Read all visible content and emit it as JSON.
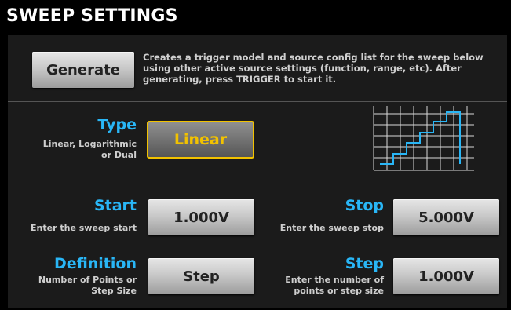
{
  "header": {
    "title": "SWEEP SETTINGS"
  },
  "generate": {
    "label": "Generate",
    "description": "Creates a trigger model and source config list for the sweep below using other active source settings (function, range, etc). After generating, press TRIGGER to start it."
  },
  "type": {
    "label": "Type",
    "subtitle_line1": "Linear, Logarithmic",
    "subtitle_line2": "or Dual",
    "value": "Linear"
  },
  "start": {
    "label": "Start",
    "subtitle": "Enter the sweep start",
    "value": "1.000V"
  },
  "stop": {
    "label": "Stop",
    "subtitle": "Enter the sweep stop",
    "value": "5.000V"
  },
  "definition": {
    "label": "Definition",
    "subtitle_line1": "Number of Points or",
    "subtitle_line2": "Step Size",
    "value": "Step"
  },
  "step": {
    "label": "Step",
    "subtitle_line1": "Enter the number of",
    "subtitle_line2": "points or step size",
    "value": "1.000V"
  },
  "colors": {
    "accent": "#29b6f6",
    "highlight": "#f2c200",
    "background": "#1b1b1b"
  },
  "icons": {
    "sweep_preview": "staircase-sweep-icon"
  }
}
